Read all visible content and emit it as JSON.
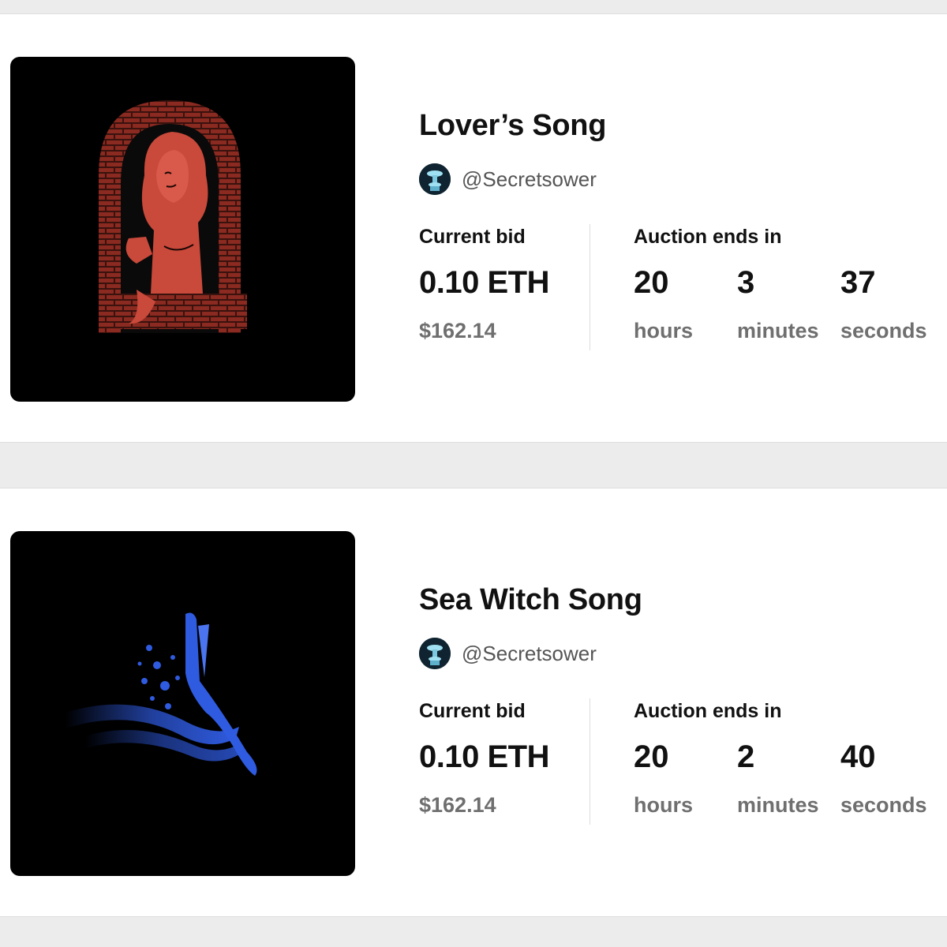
{
  "listings": [
    {
      "title": "Lover’s Song",
      "creator_handle": "@Secretsower",
      "avatar_icon": "fountain-avatar",
      "artwork": "red-woman-in-brick-window",
      "current_bid_label": "Current bid",
      "current_bid": "0.10 ETH",
      "current_bid_usd": "$162.14",
      "auction_label": "Auction ends in",
      "countdown": {
        "hours": "20",
        "hours_label": "hours",
        "minutes": "3",
        "minutes_label": "minutes",
        "seconds": "37",
        "seconds_label": "seconds"
      }
    },
    {
      "title": "Sea Witch Song",
      "creator_handle": "@Secretsower",
      "avatar_icon": "fountain-avatar",
      "artwork": "blue-diving-figure",
      "current_bid_label": "Current bid",
      "current_bid": "0.10 ETH",
      "current_bid_usd": "$162.14",
      "auction_label": "Auction ends in",
      "countdown": {
        "hours": "20",
        "hours_label": "hours",
        "minutes": "2",
        "minutes_label": "minutes",
        "seconds": "40",
        "seconds_label": "seconds"
      }
    }
  ],
  "colors": {
    "page_background": "#ececec",
    "card_background": "#ffffff",
    "muted_text": "#6f6f6f",
    "artwork_red": "#c9493a",
    "artwork_blue": "#2f5be0"
  }
}
